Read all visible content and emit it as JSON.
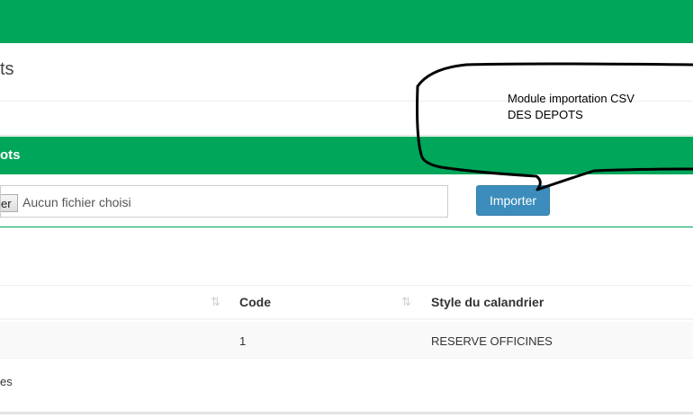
{
  "header": {
    "title_partial": "ts"
  },
  "panel": {
    "title_partial": "ots",
    "file_button_partial": "er",
    "file_status": "Aucun fichier choisi",
    "import_button": "Importer"
  },
  "annotation": {
    "line1": "Module importation CSV",
    "line2": "DES DEPOTS"
  },
  "table": {
    "columns": [
      "Code",
      "Style du calandrier"
    ],
    "sort_icon": "⇅",
    "rows": [
      {
        "code": "1",
        "style": "RESERVE OFFICINES"
      }
    ],
    "footer_partial": "es"
  },
  "colors": {
    "green": "#00a65a",
    "blue": "#3c8dbc"
  }
}
